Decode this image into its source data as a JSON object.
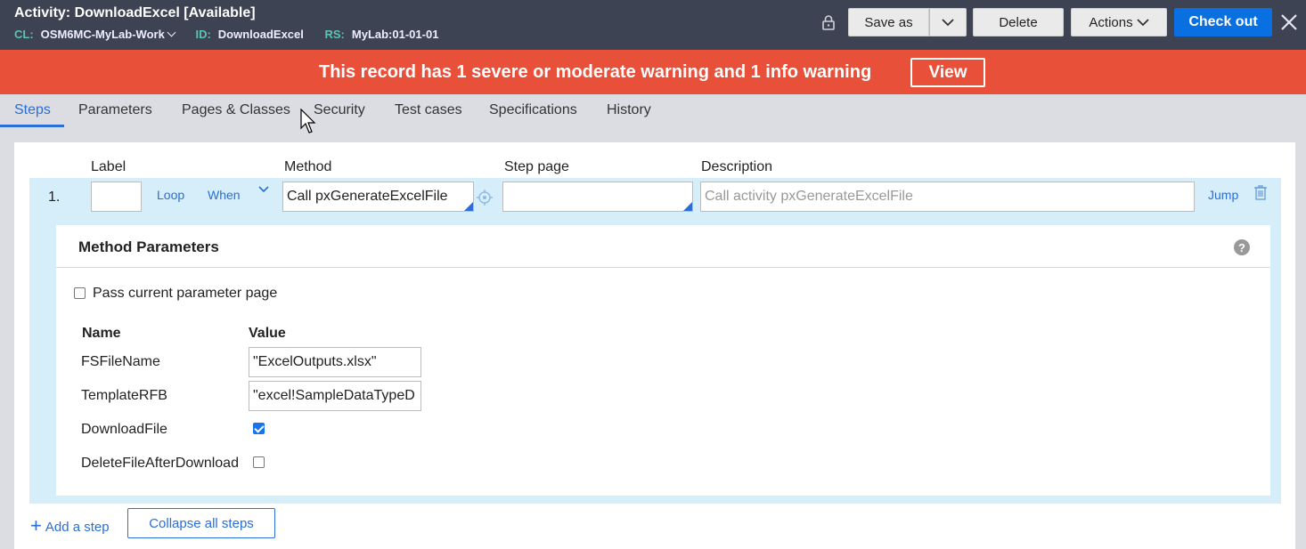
{
  "header": {
    "title": "Activity: DownloadExcel [Available]",
    "cl_key": "CL:",
    "cl_value": "OSM6MC-MyLab-Work",
    "id_key": "ID:",
    "id_value": "DownloadExcel",
    "rs_key": "RS:",
    "rs_value": "MyLab:01-01-01",
    "save_as_label": "Save as",
    "delete_label": "Delete",
    "actions_label": "Actions",
    "checkout_label": "Check out",
    "bg_color": "#3d4352",
    "checkout_color": "#0a6fe0"
  },
  "warning": {
    "text": "This record has 1 severe or moderate warning and 1 info warning",
    "view_label": "View",
    "bg_color": "#e8503a"
  },
  "tabs": [
    {
      "label": "Steps",
      "active": true
    },
    {
      "label": "Parameters"
    },
    {
      "label": "Pages & Classes"
    },
    {
      "label": "Security"
    },
    {
      "label": "Test cases"
    },
    {
      "label": "Specifications"
    },
    {
      "label": "History"
    }
  ],
  "columns": {
    "label": "Label",
    "method": "Method",
    "step_page": "Step page",
    "description": "Description"
  },
  "step": {
    "number": "1.",
    "label_value": "",
    "loop_label": "Loop",
    "when_label": "When",
    "method_value": "Call pxGenerateExcelFile",
    "step_page_value": "",
    "description_placeholder": "Call activity pxGenerateExcelFile",
    "jump_label": "Jump"
  },
  "method_parameters": {
    "title": "Method Parameters",
    "help_glyph": "?",
    "pass_current_label": "Pass current parameter page",
    "pass_current_checked": false,
    "name_header": "Name",
    "value_header": "Value",
    "params": [
      {
        "name": "FSFileName",
        "value": "\"ExcelOutputs.xlsx\""
      },
      {
        "name": "TemplateRFB",
        "value": "\"excel!SampleDataTypeD"
      },
      {
        "name": "DownloadFile",
        "checked": true
      },
      {
        "name": "DeleteFileAfterDownload",
        "checked": false
      }
    ]
  },
  "footer": {
    "add_step_label": "Add a step",
    "add_step_glyph": "+",
    "collapse_label": "Collapse all steps"
  }
}
